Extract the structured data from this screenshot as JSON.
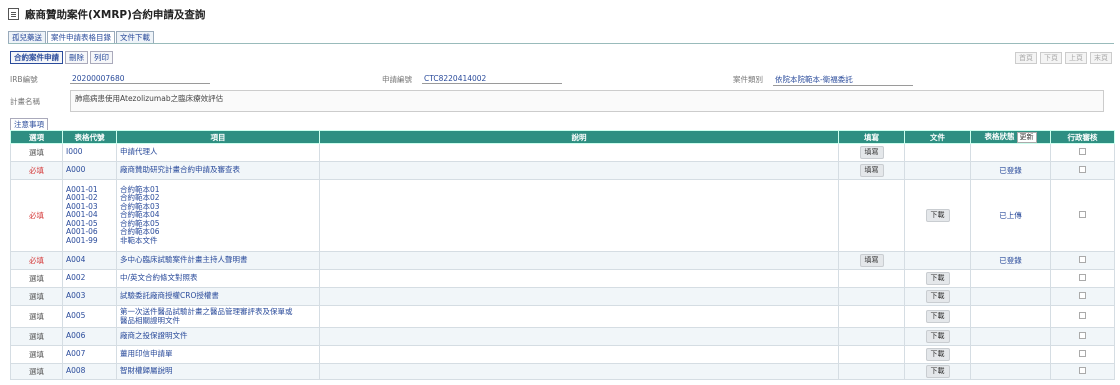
{
  "page": {
    "title": "廠商贊助案件(XMRP)合約申請及查詢"
  },
  "tabs": [
    "孤兒藥送",
    "案件申請表格目錄",
    "文件下載"
  ],
  "toolbar": {
    "apply": "合約案件申請",
    "delete": "刪除",
    "print": "列印"
  },
  "pager": [
    "首頁",
    "下頁",
    "上頁",
    "末頁"
  ],
  "info": {
    "irb_label": "IRB編號",
    "irb_value": "20200007680",
    "apply_label": "申請編號",
    "apply_value": "CTC8220414002",
    "case_label": "案件類別",
    "case_value": "依院本院範本-衛福委託",
    "plan_label": "計畫名稱",
    "plan_value": "肺癌病患使用Atezolizumab之臨床療效評估"
  },
  "notice_tab": "注意事項",
  "columns": {
    "option": "選項",
    "code": "表格代號",
    "item": "項目",
    "desc": "說明",
    "fill": "填寫",
    "doc": "文件",
    "status": "表格狀態",
    "update": "更新",
    "review": "行政審核"
  },
  "rows": [
    {
      "option": "選填",
      "req": false,
      "codes": [
        "I000"
      ],
      "items": [
        "申請代理人"
      ],
      "fill": "填寫",
      "doc": "",
      "status": ""
    },
    {
      "option": "必填",
      "req": true,
      "codes": [
        "A000"
      ],
      "items": [
        "廠商贊助研究計畫合約申請及審查表"
      ],
      "fill": "填寫",
      "doc": "",
      "status": "已登錄"
    },
    {
      "option": "必填",
      "req": true,
      "codes": [
        "A001-01",
        "A001-02",
        "A001-03",
        "A001-04",
        "A001-05",
        "A001-06",
        "A001-99"
      ],
      "items": [
        "合約範本01",
        "合約範本02",
        "合約範本03",
        "合約範本04",
        "合約範本05",
        "合約範本06",
        "非範本文件"
      ],
      "fill": "",
      "doc": "下載",
      "status": "已上傳"
    },
    {
      "option": "必填",
      "req": true,
      "codes": [
        "A004"
      ],
      "items": [
        "多中心臨床試驗案件計畫主持人聲明書"
      ],
      "fill": "填寫",
      "doc": "",
      "status": "已登錄"
    },
    {
      "option": "選填",
      "req": false,
      "codes": [
        "A002"
      ],
      "items": [
        "中/英文合約條文對照表"
      ],
      "fill": "",
      "doc": "下載",
      "status": ""
    },
    {
      "option": "選填",
      "req": false,
      "codes": [
        "A003"
      ],
      "items": [
        "試驗委託廠商授權CRO授權書"
      ],
      "fill": "",
      "doc": "下載",
      "status": ""
    },
    {
      "option": "選填",
      "req": false,
      "codes": [
        "A005"
      ],
      "items": [
        "第一次送件醫品試驗計畫之醫品管理審評表及保單或",
        "醫品相關證明文件"
      ],
      "fill": "",
      "doc": "下載",
      "status": ""
    },
    {
      "option": "選填",
      "req": false,
      "codes": [
        "A006"
      ],
      "items": [
        "廠商之投保證明文件"
      ],
      "fill": "",
      "doc": "下載",
      "status": ""
    },
    {
      "option": "選填",
      "req": false,
      "codes": [
        "A007"
      ],
      "items": [
        "薑用印信申請單"
      ],
      "fill": "",
      "doc": "下載",
      "status": ""
    },
    {
      "option": "選填",
      "req": false,
      "codes": [
        "A008"
      ],
      "items": [
        "智財權歸屬說明"
      ],
      "fill": "",
      "doc": "下載",
      "status": ""
    }
  ]
}
